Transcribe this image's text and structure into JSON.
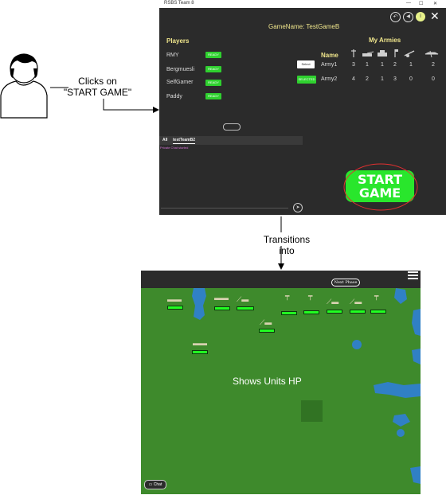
{
  "annotations": {
    "clicks_on": [
      "Clicks on",
      "\"START GAME\""
    ],
    "transitions_into": "Transitions into",
    "shows_units_hp": "Shows Units HP"
  },
  "lobby": {
    "window_title": "RSBS Team 8",
    "game_name": "GameName: TestGameB",
    "players_heading": "Players",
    "players": [
      {
        "name": "RMY",
        "status": "READY"
      },
      {
        "name": "Bergmuesli",
        "status": "READY"
      },
      {
        "name": "SelfGamer",
        "status": "READY"
      },
      {
        "name": "Paddy",
        "status": "READY"
      }
    ],
    "my_armies_heading": "My Armies",
    "armies_name_header": "Name",
    "unit_icons": [
      "soldier-icon",
      "tank-icon",
      "heavy-tank-icon",
      "flag-icon",
      "artillery-icon",
      "aircraft-icon"
    ],
    "armies": [
      {
        "action": "Select",
        "name": "Army1",
        "counts": [
          "3",
          "1",
          "1",
          "2",
          "1",
          "2"
        ]
      },
      {
        "action": "SELECTED",
        "name": "Army2",
        "counts": [
          "4",
          "2",
          "1",
          "3",
          "0",
          "0"
        ]
      }
    ],
    "chat_tabs": [
      "All",
      "testTeamB2"
    ],
    "chat_status": "Private Chat started",
    "start_button": [
      "START",
      "GAME"
    ],
    "accent_color": "#29e62c",
    "annotation_circle_color": "#e03030"
  },
  "game": {
    "next_phase_label": "Next Phase",
    "chat_button_label": "Chat",
    "map_color": "#3e8a2c",
    "water_color": "#2f7fd6",
    "hp_bar_color": "#22ff22"
  }
}
